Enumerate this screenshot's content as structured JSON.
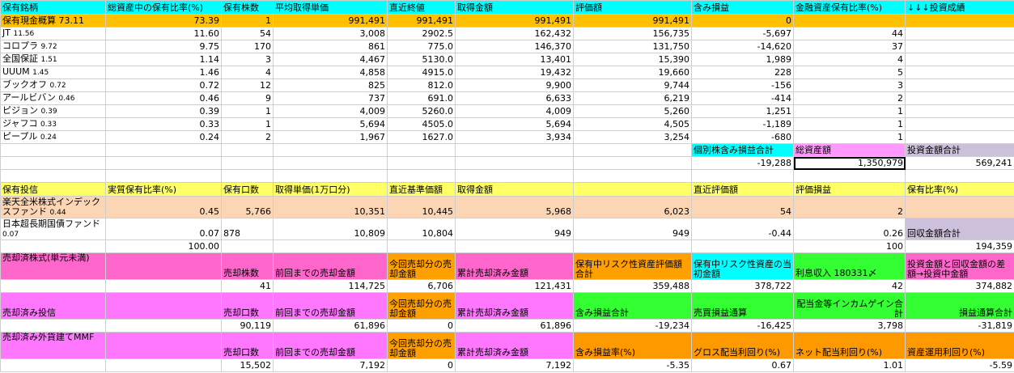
{
  "stocks": {
    "headers": [
      "保有銘柄",
      "総資産中の保有比率(%)",
      "保有株数",
      "平均取得単価",
      "直近終値",
      "取得金額",
      "評価額",
      "含み損益",
      "金融資産保有比率(%)",
      "↓↓↓投資成績"
    ],
    "cash_row": {
      "name": "保有現金概算",
      "ratio_small": "73.11",
      "ratio": "73.39",
      "shares": "1",
      "avg_price": "991,491",
      "last_price": "991,491",
      "cost": "991,491",
      "value": "991,491",
      "gain": "0",
      "fin_ratio": "",
      "extra": ""
    },
    "rows": [
      {
        "name": "JT",
        "small": "11.56",
        "ratio": "11.60",
        "shares": "54",
        "avg_price": "3,008",
        "last_price": "2902.5",
        "cost": "162,432",
        "value": "156,735",
        "gain": "-5,697",
        "fin_ratio": "44"
      },
      {
        "name": "コロプラ",
        "small": "9.72",
        "ratio": "9.75",
        "shares": "170",
        "avg_price": "861",
        "last_price": "775.0",
        "cost": "146,370",
        "value": "131,750",
        "gain": "-14,620",
        "fin_ratio": "37"
      },
      {
        "name": "全国保証",
        "small": "1.51",
        "ratio": "1.14",
        "shares": "3",
        "avg_price": "4,467",
        "last_price": "5130.0",
        "cost": "13,401",
        "value": "15,390",
        "gain": "1,989",
        "fin_ratio": "4"
      },
      {
        "name": "UUUM",
        "small": "1.45",
        "ratio": "1.46",
        "shares": "4",
        "avg_price": "4,858",
        "last_price": "4915.0",
        "cost": "19,432",
        "value": "19,660",
        "gain": "228",
        "fin_ratio": "5"
      },
      {
        "name": "ブックオフ",
        "small": "0.72",
        "ratio": "0.72",
        "shares": "12",
        "avg_price": "825",
        "last_price": "812.0",
        "cost": "9,900",
        "value": "9,744",
        "gain": "-156",
        "fin_ratio": "3"
      },
      {
        "name": "アールビバン",
        "small": "0.46",
        "ratio": "0.46",
        "shares": "9",
        "avg_price": "737",
        "last_price": "691.0",
        "cost": "6,633",
        "value": "6,219",
        "gain": "-414",
        "fin_ratio": "2"
      },
      {
        "name": "ピジョン",
        "small": "0.39",
        "ratio": "0.39",
        "shares": "1",
        "avg_price": "4,009",
        "last_price": "5260.0",
        "cost": "4,009",
        "value": "5,260",
        "gain": "1,251",
        "fin_ratio": "1"
      },
      {
        "name": "ジャフコ",
        "small": "0.33",
        "ratio": "0.33",
        "shares": "1",
        "avg_price": "5,694",
        "last_price": "4505.0",
        "cost": "5,694",
        "value": "4,505",
        "gain": "-1,189",
        "fin_ratio": "1"
      },
      {
        "name": "ピープル",
        "small": "0.24",
        "ratio": "0.24",
        "shares": "2",
        "avg_price": "1,967",
        "last_price": "1627.0",
        "cost": "3,934",
        "value": "3,254",
        "gain": "-680",
        "fin_ratio": "1"
      }
    ]
  },
  "totals": {
    "gain_total_label": "個別株含み損益合計",
    "total_assets_label": "総資産額",
    "invest_total_label": "投資金額合計",
    "gain_total": "-19,288",
    "total_assets": "1,350,979",
    "invest_total": "569,241"
  },
  "funds": {
    "headers": [
      "保有投信",
      "実質保有比率(%)",
      "保有口数",
      "取得単価(1万口分)",
      "直近基準価額",
      "取得金額",
      "直近評価額",
      "評価損益",
      "保有比率(%)"
    ],
    "rows": [
      {
        "name": "楽天全米株式インデックスファンド",
        "small": "0.44",
        "ratio": "0.45",
        "units": "5,766",
        "unit_cost": "10,351",
        "nav": "10,445",
        "cost": "5,968",
        "value": "6,023",
        "gain": "54",
        "hold_ratio": "2"
      },
      {
        "name": "日本超長期国債ファンド",
        "small": "0.07",
        "ratio": "0.07",
        "units": "878",
        "unit_cost": "10,809",
        "nav": "10,804",
        "cost": "949",
        "value": "949",
        "gain": "-0.44",
        "hold_ratio": "0.26"
      }
    ],
    "recovered_label": "回収金額合計",
    "ratio_total": "100.00",
    "hold_total": "100",
    "recovered_total": "194,359"
  },
  "sold_stocks": {
    "label": "売却済株式(単元未満)",
    "h_shares": "売却株数",
    "h_prev": "前回までの売却金額",
    "h_this": "今回売却分の売却金額",
    "h_cum": "累計売却済み金額",
    "h_risk_eval": "保有中リスク性資産評価額合計",
    "h_risk_cost": "保有中リスク性資産の当初金額",
    "h_interest": "利息収入 180331〆",
    "h_diff": "投資金額と回収金額の差額→投資中金額",
    "shares": "41",
    "prev": "114,725",
    "this": "6,706",
    "cum": "121,431",
    "risk_eval": "359,488",
    "risk_cost": "378,722",
    "interest": "42",
    "diff": "374,882"
  },
  "sold_funds": {
    "label": "売却済み投信",
    "h_units": "売却口数",
    "h_prev": "前回までの売却金額",
    "h_this": "今回売却分の売却金額",
    "h_cum": "累計売却済み金額",
    "h_unreal": "含み損益合計",
    "h_trade": "売買損益通算",
    "h_income": "配当金等インカムゲイン合計",
    "h_total": "損益通算合計",
    "units": "90,119",
    "prev": "61,896",
    "this": "0",
    "cum": "61,896",
    "unreal": "-19,234",
    "trade": "-16,425",
    "income": "3,798",
    "total": "-31,819"
  },
  "sold_mmf": {
    "label": "売却済み外貨建てMMF",
    "h_units": "売却口数",
    "h_prev": "前回までの売却金額",
    "h_this": "今回売却分の売却金額",
    "h_cum": "累計売却済み金額",
    "h_rate": "含み損益率(%)",
    "h_gross": "グロス配当利回り(%)",
    "h_net": "ネット配当利回り(%)",
    "h_roi": "資産運用利回り(%)",
    "units": "15,502",
    "prev": "7,192",
    "this": "0",
    "cum": "7,192",
    "rate": "-5.35",
    "gross": "0.67",
    "net": "1.01",
    "roi": "-5.59"
  }
}
